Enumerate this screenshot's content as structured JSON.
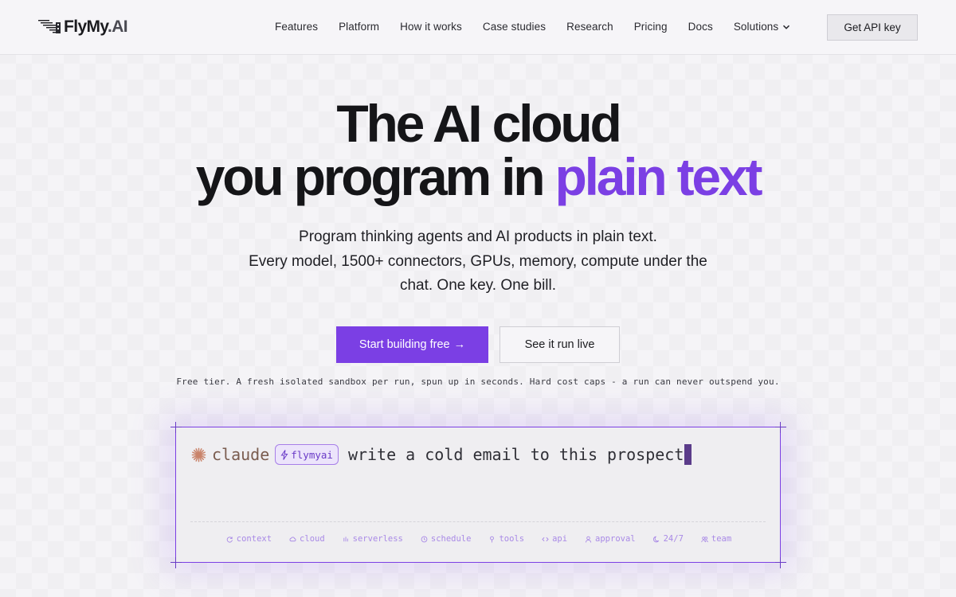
{
  "header": {
    "logo": {
      "name": "FlyMy",
      "suffix": ".AI"
    },
    "nav": [
      {
        "label": "Features"
      },
      {
        "label": "Platform"
      },
      {
        "label": "How it works"
      },
      {
        "label": "Case studies"
      },
      {
        "label": "Research"
      },
      {
        "label": "Pricing"
      },
      {
        "label": "Docs"
      },
      {
        "label": "Solutions",
        "icon": "chevron-down-icon"
      }
    ],
    "api_button": "Get API key"
  },
  "hero": {
    "title_line1": "The AI cloud",
    "title_line2_prefix": "you program in ",
    "title_line2_accent": "plain text",
    "subtitle_line1": "Program thinking agents and AI products in plain text.",
    "subtitle_line2": "Every model, 1500+ connectors, GPUs, memory, compute under the",
    "subtitle_line3": "chat. One key. One bill.",
    "primary_cta": "Start building free",
    "primary_cta_arrow": "→",
    "secondary_cta": "See it run live",
    "fine_print": "Free tier. A fresh isolated sandbox per run, spun up in seconds. Hard cost caps - a run can never outspend you."
  },
  "prompt_box": {
    "agent": "claude",
    "chip": "flymyai",
    "text": "write a cold email to this prospect",
    "tags": [
      {
        "label": "context",
        "icon": "refresh-icon"
      },
      {
        "label": "cloud",
        "icon": "cloud-icon"
      },
      {
        "label": "serverless",
        "icon": "bars-icon"
      },
      {
        "label": "schedule",
        "icon": "clock-icon"
      },
      {
        "label": "tools",
        "icon": "pin-icon"
      },
      {
        "label": "api",
        "icon": "code-icon"
      },
      {
        "label": "approval",
        "icon": "user-icon"
      },
      {
        "label": "24/7",
        "icon": "moon-icon"
      },
      {
        "label": "team",
        "icon": "users-icon"
      }
    ]
  },
  "colors": {
    "accent": "#7b3fe4",
    "text": "#151518",
    "background": "#f5f4f7",
    "tag": "#a98ae6"
  }
}
